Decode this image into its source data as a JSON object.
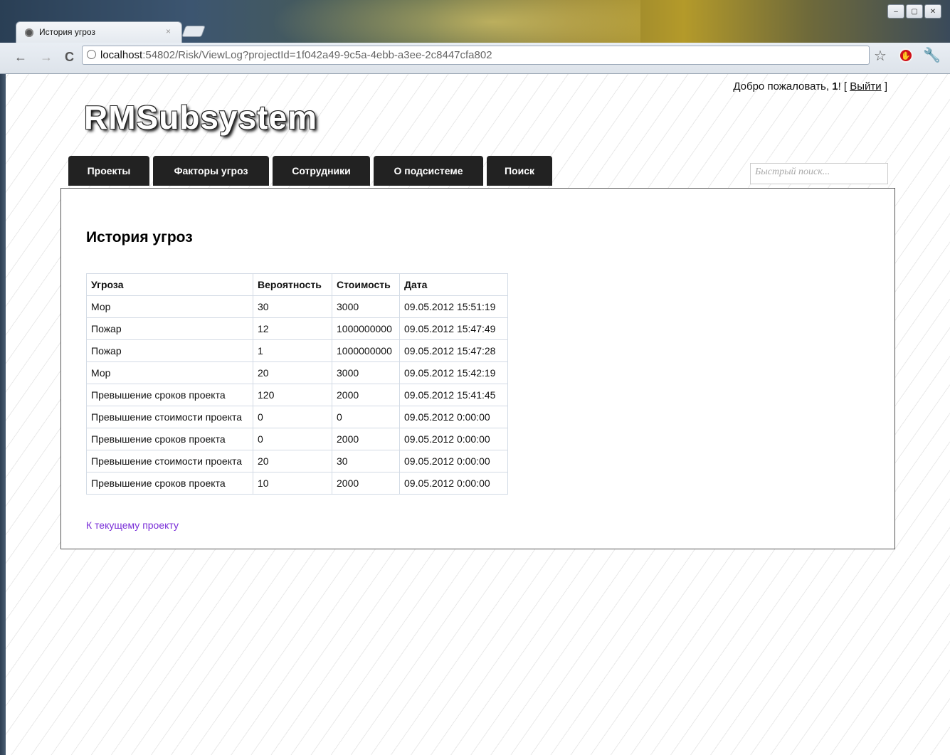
{
  "browser": {
    "tab_title": "История угроз",
    "tab_close": "×",
    "url_host": "localhost",
    "url_rest": ":54802/Risk/ViewLog?projectId=1f042a49-9c5a-4ebb-a3ee-2c8447cfa802",
    "back_glyph": "←",
    "forward_glyph": "→",
    "reload_glyph": "C",
    "star_glyph": "☆",
    "wrench_glyph": "🔧",
    "win_minimize": "–",
    "win_maximize": "▢",
    "win_close": "✕"
  },
  "header": {
    "welcome_prefix": "Добро пожаловать, ",
    "user": "1",
    "welcome_suffix": "! [ ",
    "logout": "Выйти",
    "welcome_end": " ]",
    "logo": "RMSubsystem"
  },
  "menu": [
    {
      "label": "Проекты"
    },
    {
      "label": "Факторы угроз"
    },
    {
      "label": "Сотрудники"
    },
    {
      "label": "О подсистеме"
    },
    {
      "label": "Поиск"
    }
  ],
  "search": {
    "placeholder": "Быстрый поиск..."
  },
  "main": {
    "title": "История угроз",
    "columns": [
      "Угроза",
      "Вероятность",
      "Стоимость",
      "Дата"
    ],
    "rows": [
      [
        "Мор",
        "30",
        "3000",
        "09.05.2012 15:51:19"
      ],
      [
        "Пожар",
        "12",
        "1000000000",
        "09.05.2012 15:47:49"
      ],
      [
        "Пожар",
        "1",
        "1000000000",
        "09.05.2012 15:47:28"
      ],
      [
        "Мор",
        "20",
        "3000",
        "09.05.2012 15:42:19"
      ],
      [
        "Превышение сроков проекта",
        "120",
        "2000",
        "09.05.2012 15:41:45"
      ],
      [
        "Превышение стоимости проекта",
        "0",
        "0",
        "09.05.2012 0:00:00"
      ],
      [
        "Превышение сроков проекта",
        "0",
        "2000",
        "09.05.2012 0:00:00"
      ],
      [
        "Превышение стоимости проекта",
        "20",
        "30",
        "09.05.2012 0:00:00"
      ],
      [
        "Превышение сроков проекта",
        "10",
        "2000",
        "09.05.2012 0:00:00"
      ]
    ],
    "back_link": "К текущему проекту"
  },
  "colors": {
    "menu_bg": "#222222",
    "link": "#7a2fd8",
    "table_border": "#d3dbe5"
  }
}
